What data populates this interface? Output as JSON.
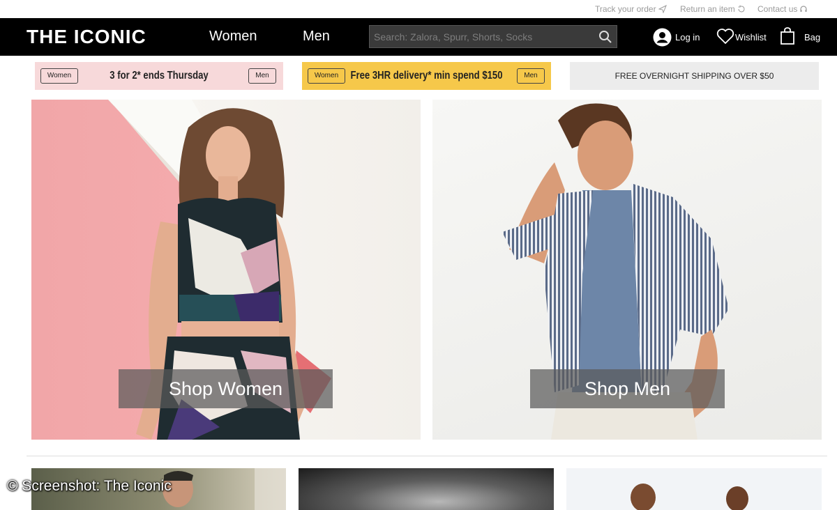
{
  "utility": {
    "track_order": "Track your order",
    "return_item": "Return an item",
    "contact_us": "Contact us"
  },
  "header": {
    "logo": "THE ICONIC",
    "nav": [
      "Women",
      "Men"
    ],
    "search_placeholder": "Search: Zalora, Spurr, Shorts, Socks",
    "login": "Log in",
    "wishlist": "Wishlist",
    "bag": "Bag"
  },
  "promos": [
    {
      "left_btn": "Women",
      "text": "3 for 2* ends Thursday",
      "right_btn": "Men",
      "bg": "#f7d9da"
    },
    {
      "left_btn": "Women",
      "text": "Free 3HR delivery* min spend $150",
      "right_btn": "Men",
      "bg": "#f6c84a"
    },
    {
      "text": "FREE OVERNIGHT SHIPPING OVER $50",
      "bg": "#ececec"
    }
  ],
  "hero": {
    "women_cta": "Shop Women",
    "men_cta": "Shop Men"
  },
  "credit": "© Screenshot: The Iconic"
}
